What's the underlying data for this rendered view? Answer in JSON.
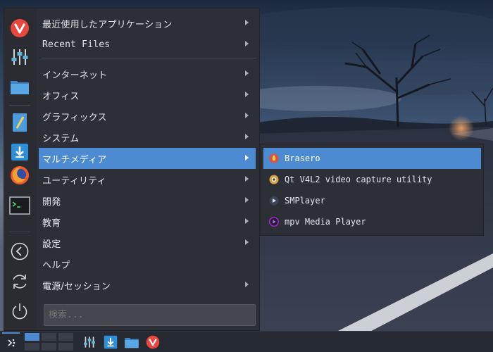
{
  "menu": {
    "categories": [
      {
        "label": "最近使用したアプリケーション",
        "has_submenu": true
      },
      {
        "label": "Recent Files",
        "has_submenu": true
      },
      {
        "label": "インターネット",
        "has_submenu": true
      },
      {
        "label": "オフィス",
        "has_submenu": true
      },
      {
        "label": "グラフィックス",
        "has_submenu": true
      },
      {
        "label": "システム",
        "has_submenu": true
      },
      {
        "label": "マルチメディア",
        "has_submenu": true,
        "active": true
      },
      {
        "label": "ユーティリティ",
        "has_submenu": true
      },
      {
        "label": "開発",
        "has_submenu": true
      },
      {
        "label": "教育",
        "has_submenu": true
      },
      {
        "label": "設定",
        "has_submenu": true
      },
      {
        "label": "ヘルプ",
        "has_submenu": false
      },
      {
        "label": "電源/セッション",
        "has_submenu": true
      }
    ],
    "search_placeholder": "検索...",
    "favorites": [
      "vivaldi-icon",
      "mixer-settings-icon",
      "folder-icon",
      "text-editor-icon",
      "download-icon",
      "firefox-icon",
      "terminal-icon"
    ],
    "session_buttons": [
      "back-icon",
      "refresh-icon",
      "power-icon"
    ]
  },
  "submenu": {
    "items": [
      {
        "label": "Brasero",
        "icon": "brasero-icon",
        "active": true
      },
      {
        "label": "Qt V4L2 video capture utility",
        "icon": "webcam-icon"
      },
      {
        "label": "SMPlayer",
        "icon": "smplayer-icon"
      },
      {
        "label": "mpv Media Player",
        "icon": "mpv-icon"
      }
    ]
  },
  "taskbar": {
    "pager_current": 1,
    "pager_count": 6,
    "apps": [
      "mixer-settings-icon",
      "download-icon",
      "folder-icon",
      "vivaldi-icon"
    ]
  },
  "colors": {
    "accent": "#4c8ad2",
    "panel": "#2d2f36",
    "taskbar": "#262a33"
  }
}
